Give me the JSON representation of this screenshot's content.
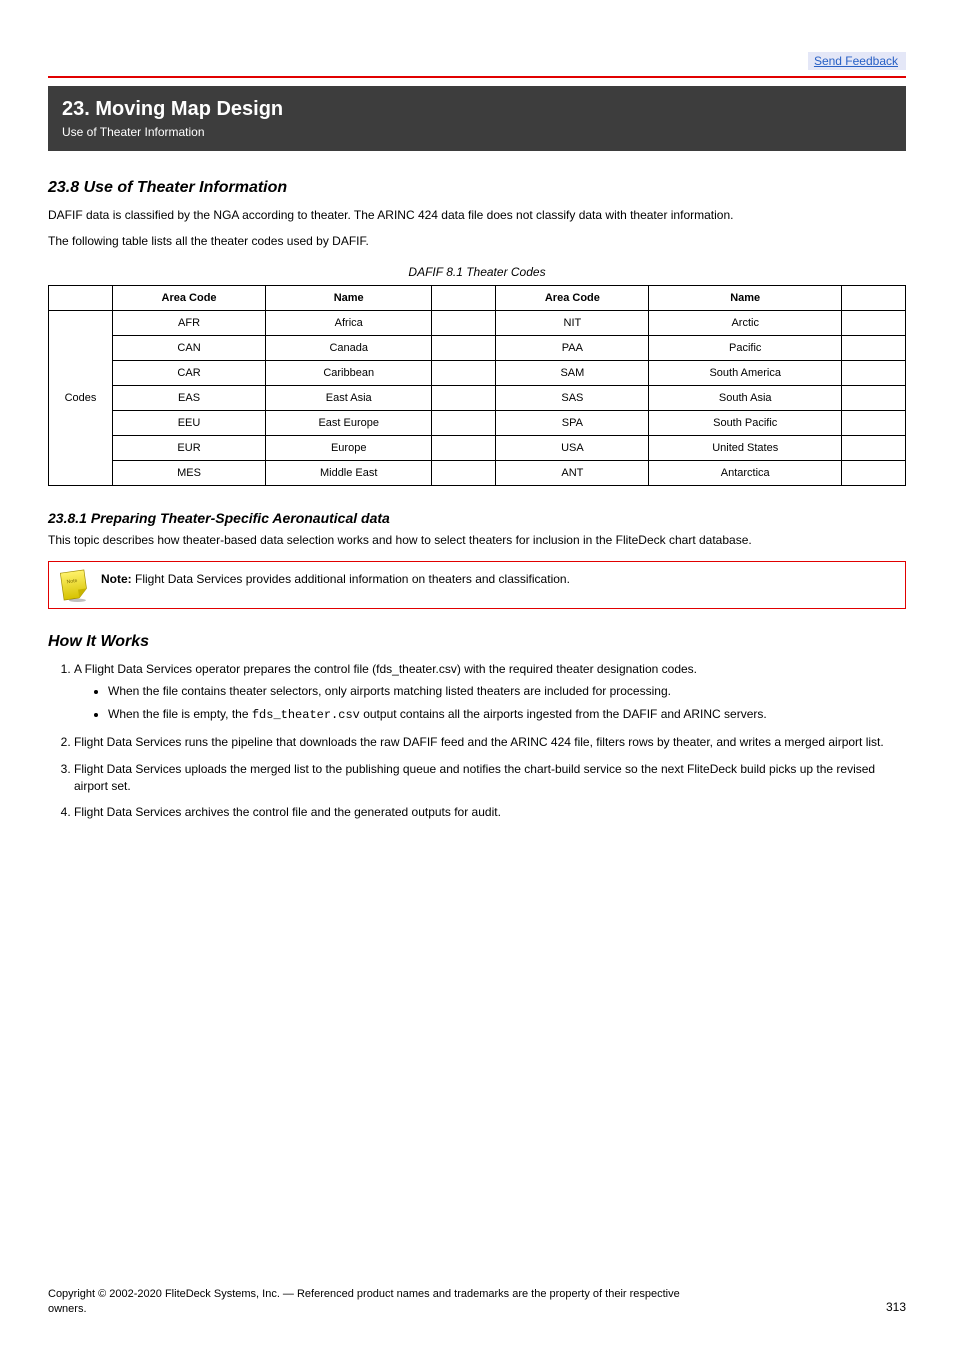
{
  "header": {
    "feedback_link": "Send Feedback"
  },
  "chapter": {
    "name": "23. Moving Map Design",
    "topic": "Use of Theater Information"
  },
  "sections": {
    "intro_title": "23.8 Use of Theater Information",
    "intro_p1": "DAFIF data is classified by the NGA according to theater. The ARINC 424 data file does not classify data with theater information.",
    "intro_p2": "The following table lists all the theater codes used by DAFIF."
  },
  "table": {
    "caption": "DAFIF 8.1 Theater Codes",
    "headers": [
      "",
      "Area Code",
      "Name",
      "",
      "Area Code",
      "Name",
      ""
    ],
    "rows": [
      [
        "",
        "AFR",
        "Africa",
        "",
        "NIT",
        "Arctic",
        ""
      ],
      [
        "",
        "CAN",
        "Canada",
        "",
        "PAA",
        "Pacific",
        ""
      ],
      [
        "",
        "CAR",
        "Caribbean",
        "",
        "SAM",
        "South America",
        ""
      ],
      [
        "",
        "EAS",
        "East Asia",
        "",
        "SAS",
        "South Asia",
        ""
      ],
      [
        "",
        "EEU",
        "East Europe",
        "",
        "SPA",
        "South Pacific",
        ""
      ],
      [
        "",
        "EUR",
        "Europe",
        "",
        "USA",
        "United States",
        ""
      ],
      [
        "",
        "MES",
        "Middle East",
        "",
        "ANT",
        "Antarctica",
        ""
      ]
    ],
    "rowspan_label": "Codes"
  },
  "sub": {
    "title": "23.8.1 Preparing Theater-Specific Aeronautical data",
    "p1": "This topic describes how theater-based data selection works and how to select theaters for inclusion in the FliteDeck chart database."
  },
  "note": {
    "label": "Note:",
    "text": "Flight Data Services provides additional information on theaters and classification."
  },
  "howit": {
    "title": "How It Works",
    "step1": "A Flight Data Services operator prepares the control file (fds_theater.csv) with the required theater designation codes.",
    "bullet1": "When the file contains theater selectors, only airports matching listed theaters are included for processing.",
    "bullet2_a": "When the file is empty, the ",
    "bullet2_mono": "fds_theater.csv",
    "bullet2_b": " output contains all the airports ingested from the DAFIF and ARINC servers.",
    "step2": "Flight Data Services runs the pipeline that downloads the raw DAFIF feed and the ARINC 424 file, filters rows by theater, and writes a merged airport list.",
    "step3": "Flight Data Services uploads the merged list to the publishing queue and notifies the chart-build service so the next FliteDeck build picks up the revised airport set.",
    "step4": "Flight Data Services archives the control file and the generated outputs for audit."
  },
  "footer": {
    "copyright": "Copyright © 2002-2020 FliteDeck Systems, Inc. — Referenced product names and trademarks are the property of their respective owners.",
    "pagenum": "313"
  }
}
